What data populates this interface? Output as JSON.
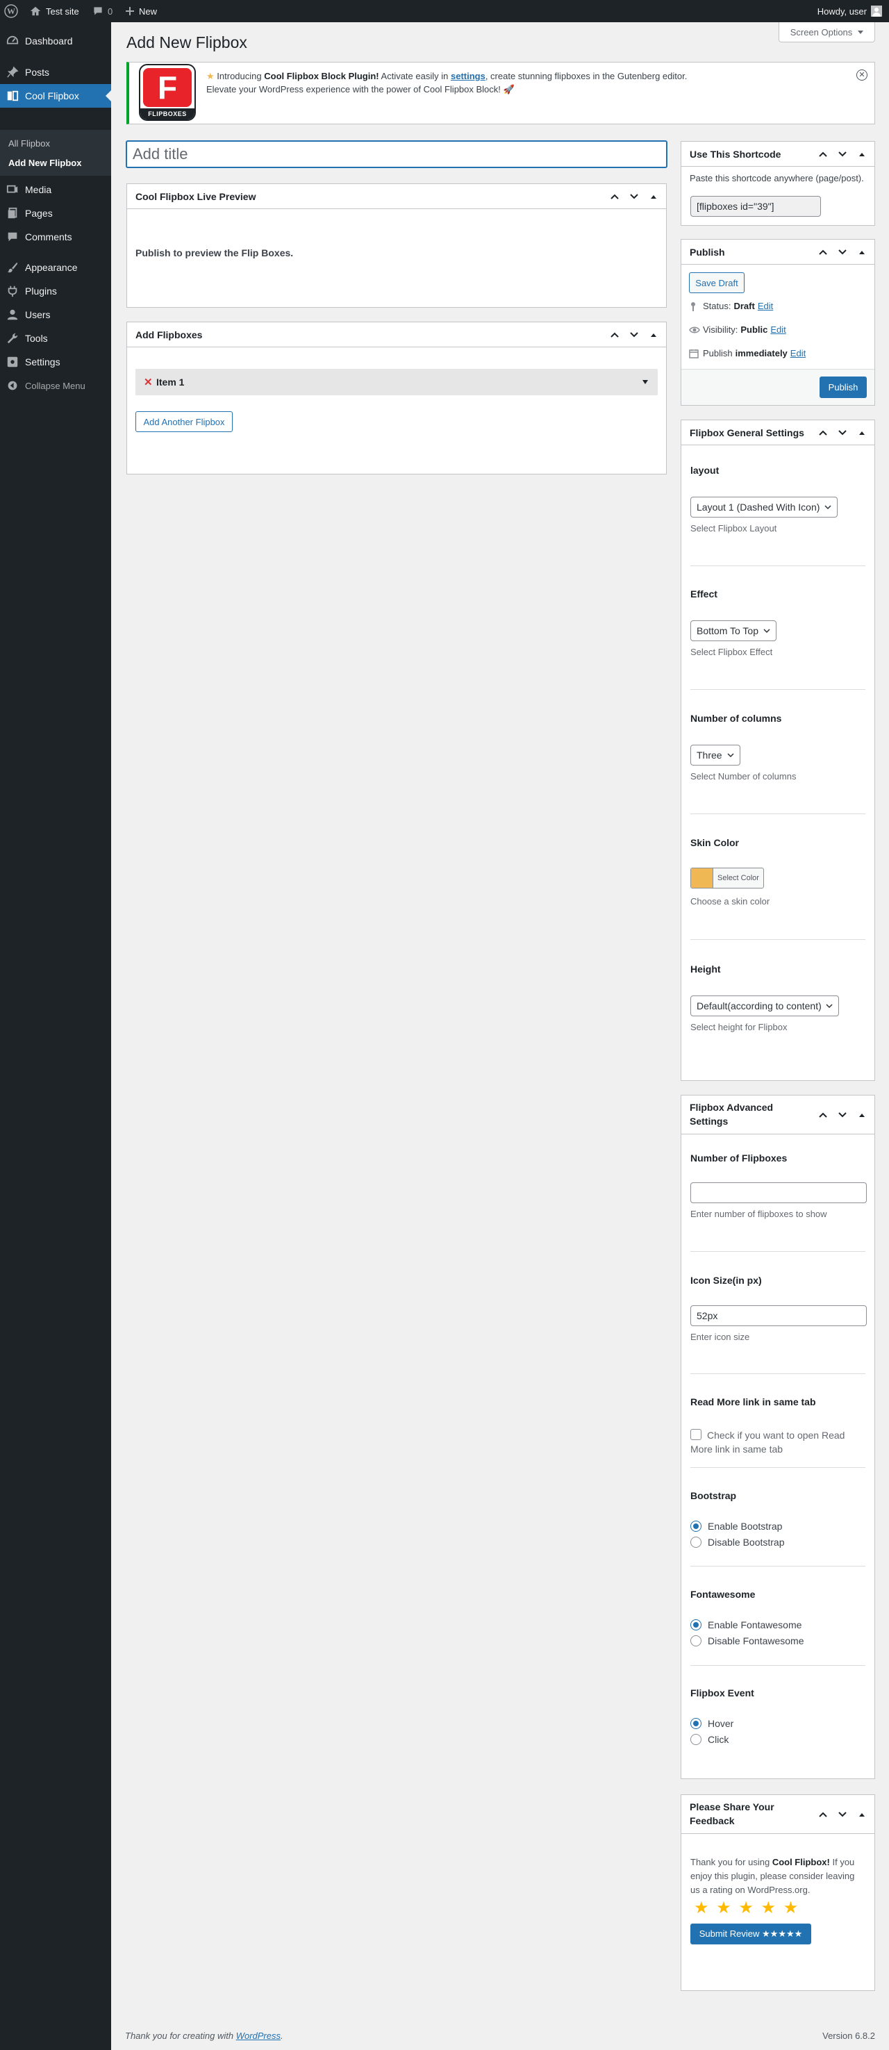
{
  "admin_bar": {
    "site_name": "Test site",
    "comments_count": "0",
    "new_label": "New",
    "howdy": "Howdy, user"
  },
  "sidebar": {
    "items": [
      {
        "label": "Dashboard",
        "icon": "dashboard-icon"
      },
      {
        "label": "Posts",
        "icon": "pin-icon"
      },
      {
        "label": "Cool Flipbox",
        "icon": "flipbox-icon"
      },
      {
        "label": "Media",
        "icon": "media-icon"
      },
      {
        "label": "Pages",
        "icon": "pages-icon"
      },
      {
        "label": "Comments",
        "icon": "comments-icon"
      },
      {
        "label": "Appearance",
        "icon": "brush-icon"
      },
      {
        "label": "Plugins",
        "icon": "plugin-icon"
      },
      {
        "label": "Users",
        "icon": "users-icon"
      },
      {
        "label": "Tools",
        "icon": "wrench-icon"
      },
      {
        "label": "Settings",
        "icon": "settings-icon"
      }
    ],
    "submenu": [
      "All Flipbox",
      "Add New Flipbox"
    ],
    "collapse_label": "Collapse Menu"
  },
  "page": {
    "title": "Add New Flipbox",
    "screen_options": "Screen Options"
  },
  "notice": {
    "logo_letter": "F",
    "logo_text": "FLIPBOXES",
    "intro": "Introducing",
    "plugin_name": "Cool Flipbox Block Plugin!",
    "activate_text": "Activate easily in",
    "settings_link": "settings",
    "rest": ", create stunning flipboxes in the Gutenberg editor.",
    "line2": "Elevate your WordPress experience with the power of Cool Flipbox Block! 🚀"
  },
  "editor": {
    "title_placeholder": "Add title",
    "preview": {
      "title": "Cool Flipbox Live Preview",
      "message": "Publish to preview the Flip Boxes."
    },
    "add_flipboxes": {
      "title": "Add Flipboxes",
      "item_label": "Item 1",
      "add_button": "Add Another Flipbox"
    }
  },
  "shortcode": {
    "title": "Use This Shortcode",
    "desc": "Paste this shortcode anywhere (page/post).",
    "value": "[flipboxes id=\"39\"]"
  },
  "publish": {
    "title": "Publish",
    "save_draft": "Save Draft",
    "status_label": "Status:",
    "status_value": "Draft",
    "visibility_label": "Visibility:",
    "visibility_value": "Public",
    "publish_label": "Publish",
    "publish_value": "immediately",
    "edit": "Edit",
    "publish_button": "Publish"
  },
  "general_settings": {
    "title": "Flipbox General Settings",
    "layout": {
      "label": "layout",
      "value": "Layout 1 (Dashed With Icon)",
      "desc": "Select Flipbox Layout"
    },
    "effect": {
      "label": "Effect",
      "value": "Bottom To Top",
      "desc": "Select Flipbox Effect"
    },
    "columns": {
      "label": "Number of columns",
      "value": "Three",
      "desc": "Select Number of columns"
    },
    "skin": {
      "label": "Skin Color",
      "button": "Select Color",
      "desc": "Choose a skin color",
      "color": "#f0b755"
    },
    "height": {
      "label": "Height",
      "value": "Default(according to content)",
      "desc": "Select height for Flipbox"
    }
  },
  "advanced_settings": {
    "title_line1": "Flipbox Advanced",
    "title_line2": "Settings",
    "num_flipboxes": {
      "label": "Number of Flipboxes",
      "value": "",
      "desc": "Enter number of flipboxes to show"
    },
    "icon_size": {
      "label": "Icon Size(in px)",
      "value": "52px",
      "desc": "Enter icon size"
    },
    "read_more": {
      "label": "Read More link in same tab",
      "line1": "Check if you want to open Read",
      "line2": "More link in same tab"
    },
    "bootstrap": {
      "label": "Bootstrap",
      "options": [
        "Enable Bootstrap",
        "Disable Bootstrap"
      ],
      "selected": 0
    },
    "fontawesome": {
      "label": "Fontawesome",
      "options": [
        "Enable Fontawesome",
        "Disable Fontawesome"
      ],
      "selected": 0
    },
    "event": {
      "label": "Flipbox Event",
      "options": [
        "Hover",
        "Click"
      ],
      "selected": 0
    }
  },
  "feedback": {
    "title_line1": "Please Share Your",
    "title_line2": "Feedback",
    "line1_a": "Thank you for using",
    "line1_b": "Cool Flipbox!",
    "line1_c": "If you",
    "line2": "enjoy this plugin, please consider leaving",
    "line3": "us a rating on WordPress.org.",
    "stars": "★ ★ ★ ★ ★",
    "button": "Submit Review ★★★★★",
    "star_color": "#ffb900"
  },
  "footer": {
    "thanks": "Thank you for creating with",
    "wp_link": "WordPress",
    "period": ".",
    "version": "Version 6.8.2"
  }
}
